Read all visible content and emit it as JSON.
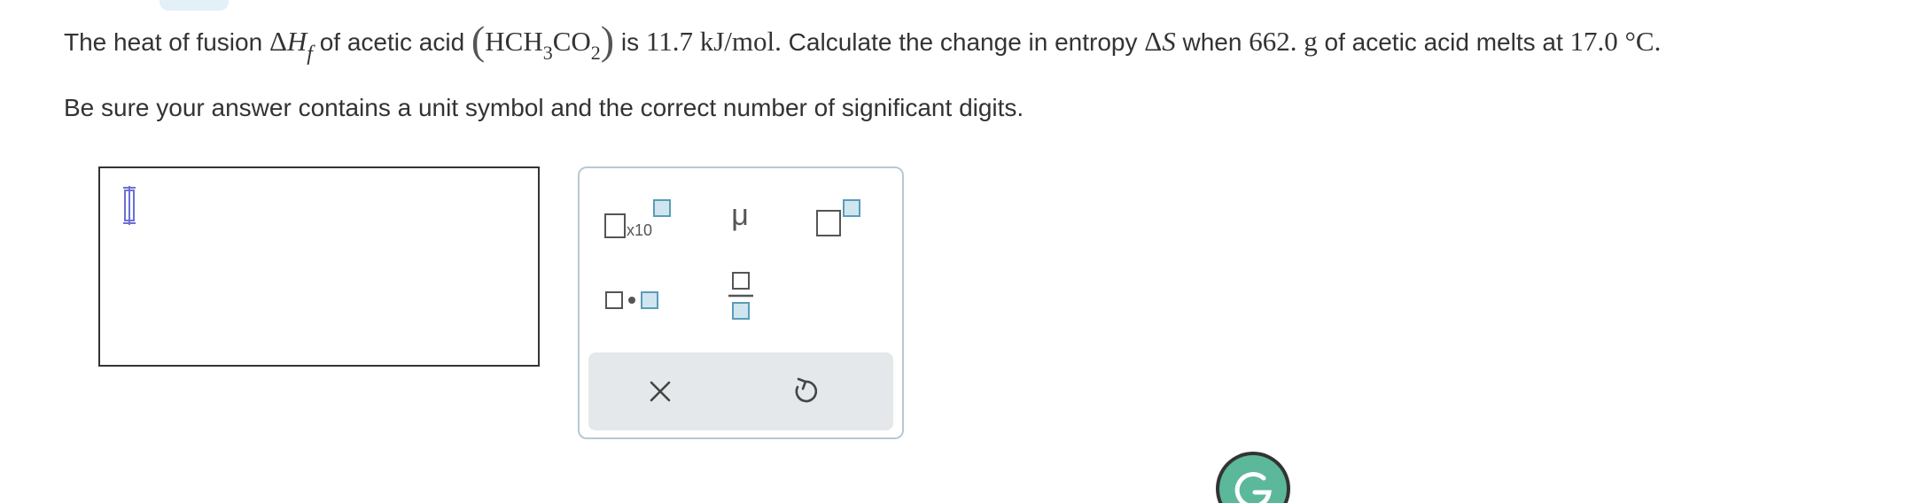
{
  "question": {
    "p1": "The heat of fusion ",
    "delta_h": "Δ",
    "h_var": "H",
    "h_sub": "f",
    "p2": " of acetic acid ",
    "formula_a": "HCH",
    "formula_sub1": "3",
    "formula_b": "CO",
    "formula_sub2": "2",
    "p3": " is ",
    "enthalpy": "11.7 kJ/mol.",
    "p4": " Calculate the change in entropy ",
    "delta_s": "Δ",
    "s_var": "S",
    "p5": " when ",
    "mass": "662. g",
    "p6": " of acetic acid melts at ",
    "temperature": "17.0 °C."
  },
  "instruction": "Be sure your answer contains a unit symbol and the correct number of significant digits.",
  "answer": {
    "value": ""
  },
  "palette": {
    "sci_notation_label": "x10",
    "micro_label": "μ",
    "buttons": [
      "scientific-notation-icon",
      "micro-prefix",
      "superscript-icon",
      "multiply-dot-icon",
      "fraction-icon",
      "clear-icon",
      "undo-icon"
    ]
  },
  "colors": {
    "accent_blue": "#5a9cb8",
    "box_fill": "#cfe6f0",
    "cursor_blue": "#6b6fd6",
    "footer_bg": "#e4e8ea",
    "palette_border": "#b7c9d3",
    "grammarly_green": "#5cb89a"
  }
}
